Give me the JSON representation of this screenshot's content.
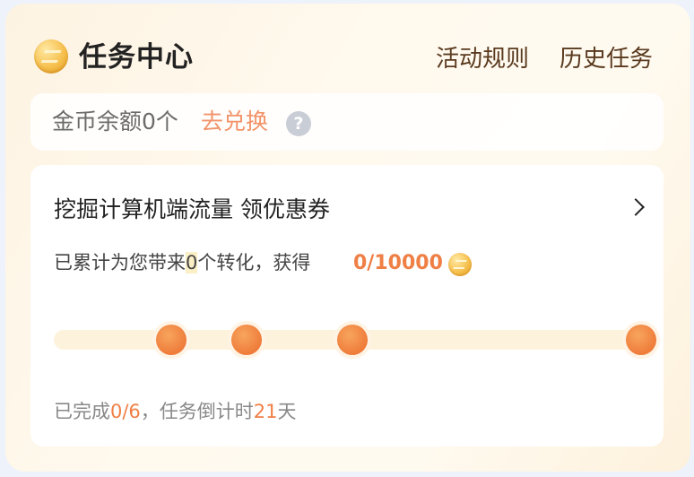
{
  "header": {
    "title": "任务中心",
    "rules_label": "活动规则",
    "history_label": "历史任务"
  },
  "balance": {
    "text": "金币余额0个",
    "exchange_label": "去兑换",
    "help_glyph": "?"
  },
  "task": {
    "title": "挖掘计算机端流量 领优惠券",
    "summary_prefix": "已累计为您带来",
    "summary_count": "0",
    "summary_suffix": "个转化，获得",
    "reward": "0/10000",
    "progress": 0
  },
  "footer": {
    "done_prefix": "已完成",
    "done_value": "0/6",
    "countdown_prefix": "，任务倒计时",
    "days_value": "21",
    "days_unit": "天"
  },
  "colors": {
    "accent": "#ef7f45",
    "link": "#f2936a",
    "track": "#fdf2dc"
  },
  "icons": {
    "coin": "coin-icon",
    "help": "help-icon",
    "chevron": "chevron-right-icon"
  }
}
